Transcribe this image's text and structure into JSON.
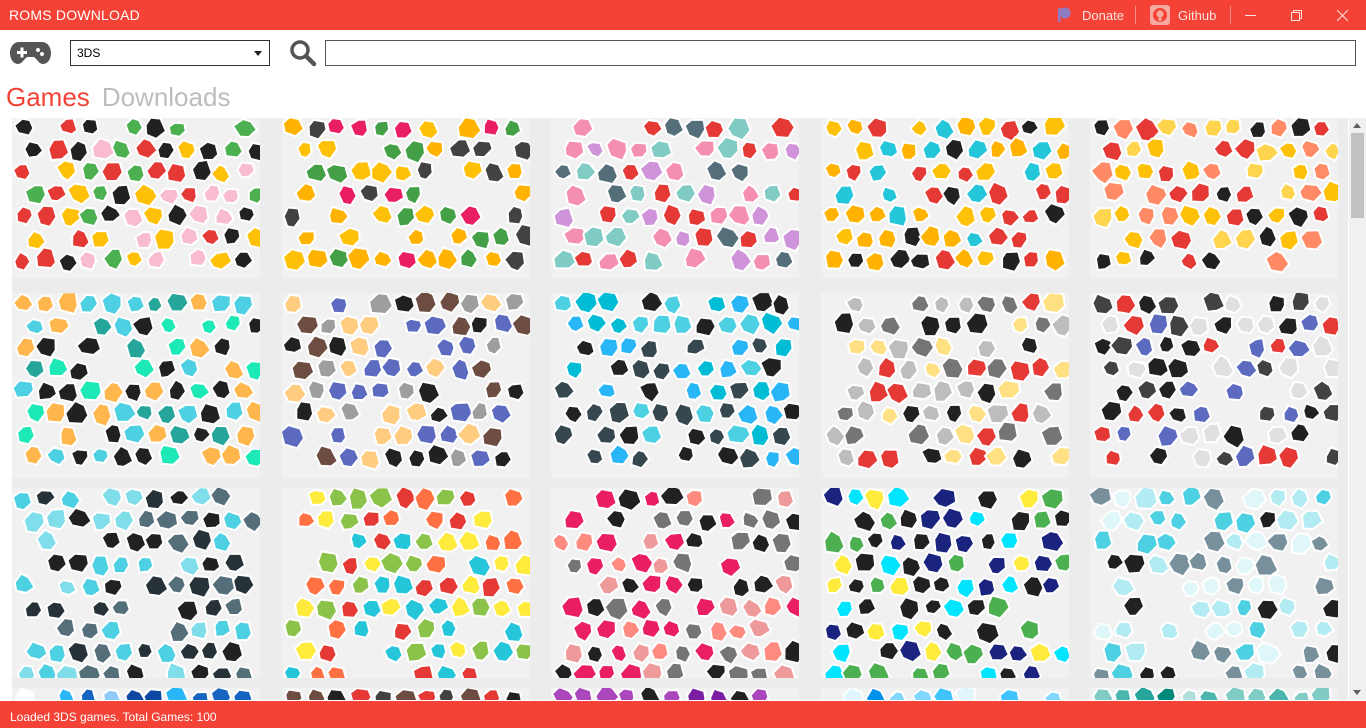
{
  "window": {
    "title": "ROMS DOWNLOAD",
    "donate_label": "Donate",
    "github_label": "Github",
    "minimize_glyph": "—",
    "restore_glyph": "❐",
    "close_glyph": "✕"
  },
  "toolbar": {
    "console_select": {
      "value": "3DS"
    },
    "search": {
      "value": "",
      "placeholder": ""
    }
  },
  "tabs": [
    {
      "label": "Games",
      "active": true
    },
    {
      "label": "Downloads",
      "active": false
    }
  ],
  "grid": {
    "tiles": [
      {
        "palette": [
          "#ffc107",
          "#4caf50",
          "#e53935",
          "#212121",
          "#f8bbd0"
        ]
      },
      {
        "palette": [
          "#ffb300",
          "#ffc107",
          "#e91e63",
          "#43a047",
          "#424242"
        ]
      },
      {
        "palette": [
          "#ce93d8",
          "#f48fb1",
          "#80cbc4",
          "#546e7a",
          "#e53935"
        ]
      },
      {
        "palette": [
          "#ffc107",
          "#ffb300",
          "#212121",
          "#e53935",
          "#26c6da"
        ]
      },
      {
        "palette": [
          "#ffc107",
          "#e53935",
          "#212121",
          "#ff8a65",
          "#ffd54f"
        ]
      },
      {
        "palette": [
          "#1de9b6",
          "#26a69a",
          "#4dd0e1",
          "#212121",
          "#ffb74d"
        ]
      },
      {
        "palette": [
          "#212121",
          "#6d4c41",
          "#ffcc80",
          "#5c6bc0",
          "#9e9e9e"
        ]
      },
      {
        "palette": [
          "#29b6f6",
          "#00bcd4",
          "#37474f",
          "#212121",
          "#4dd0e1"
        ]
      },
      {
        "palette": [
          "#bdbdbd",
          "#212121",
          "#e53935",
          "#ffe082",
          "#757575"
        ]
      },
      {
        "palette": [
          "#e0e0e0",
          "#424242",
          "#e53935",
          "#5c6bc0",
          "#212121"
        ]
      },
      {
        "palette": [
          "#4dd0e1",
          "#263238",
          "#546e7a",
          "#80deea",
          "#212121"
        ]
      },
      {
        "palette": [
          "#ffeb3b",
          "#8bc34a",
          "#e53935",
          "#ff7043",
          "#26c6da"
        ]
      },
      {
        "palette": [
          "#ef9a9a",
          "#212121",
          "#e91e63",
          "#ff8a80",
          "#757575"
        ]
      },
      {
        "palette": [
          "#00e5ff",
          "#4caf50",
          "#1a237e",
          "#212121",
          "#ffeb3b"
        ]
      },
      {
        "palette": [
          "#b2ebf2",
          "#4dd0e1",
          "#212121",
          "#78909c",
          "#e0f7fa"
        ]
      },
      {
        "palette": [
          "#29b6f6",
          "#90caf9",
          "#1565c0",
          "#ffffff",
          "#0d47a1"
        ]
      },
      {
        "palette": [
          "#212121",
          "#e53935",
          "#ff7043",
          "#424242",
          "#6d4c41"
        ]
      },
      {
        "palette": [
          "#4a148c",
          "#7b1fa2",
          "#ab47bc",
          "#212121",
          "#ce93d8"
        ]
      },
      {
        "palette": [
          "#00b0ff",
          "#40c4ff",
          "#80d8ff",
          "#0091ea",
          "#e1f5fe"
        ]
      },
      {
        "palette": [
          "#26a69a",
          "#4db6ac",
          "#80cbc4",
          "#b2dfdb",
          "#00897b"
        ]
      }
    ]
  },
  "status": {
    "text": "Loaded 3DS games. Total Games: 100"
  }
}
